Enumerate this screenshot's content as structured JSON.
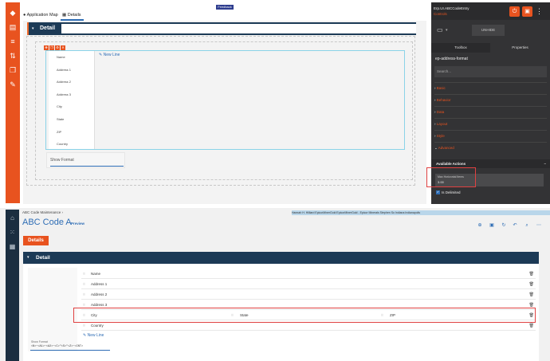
{
  "top": {
    "feedback_label": "Feedback",
    "tabs": [
      {
        "label": "Application Map",
        "icon": "globe-icon"
      },
      {
        "label": "Details",
        "icon": "grid-icon"
      }
    ],
    "detail_header": "Detail",
    "fields": [
      "Name",
      "Address 1",
      "Address 2",
      "Address 3",
      "City",
      "State",
      "ZIP",
      "Country"
    ],
    "new_line_label": "New Line",
    "show_format_label": "Show Format"
  },
  "side": {
    "title": "Erp.UI.ABCCodeEntry",
    "subtitle": "Controls",
    "unhide_label": "UNHIDE",
    "tabs": [
      "Toolbox",
      "Properties"
    ],
    "component_name": "ep-address-format",
    "search_placeholder": "Search...",
    "sections": [
      "Basic",
      "Behavior",
      "Data",
      "Layout",
      "Style",
      "Advanced"
    ],
    "available_actions": "Available Actions",
    "max_horizontal_label": "Max Horizontal Items",
    "max_horizontal_value": "3.00",
    "is_delimited_label": "Is Delimited"
  },
  "bottom": {
    "breadcrumb": "ABC Code Maintenance",
    "status": "Hannah H. Hilliard   EpicorMinerGold   EpicorMinerGold - Epicor Minerals   Stephen So   Indiana Indianapolis",
    "title": "ABC Code A",
    "preview_label": "Preview",
    "details_button": "Details",
    "detail_header": "Detail",
    "rows": [
      {
        "cells": [
          "Name"
        ]
      },
      {
        "cells": [
          "Address 1"
        ]
      },
      {
        "cells": [
          "Address 2"
        ]
      },
      {
        "cells": [
          "Address 3"
        ]
      },
      {
        "cells": [
          "City",
          "State",
          "ZIP"
        ]
      },
      {
        "cells": [
          "Country"
        ]
      }
    ],
    "new_line_label": "New Line",
    "show_format_label": "Show Format",
    "show_format_value": "<N>~<A1>~<A2>~<C>\"<S>\"<Z>~<CNT>"
  },
  "colors": {
    "accent": "#e8531f",
    "header_navy": "#1c3a56",
    "link_blue": "#2e6db5",
    "highlight_red": "#e04141"
  }
}
